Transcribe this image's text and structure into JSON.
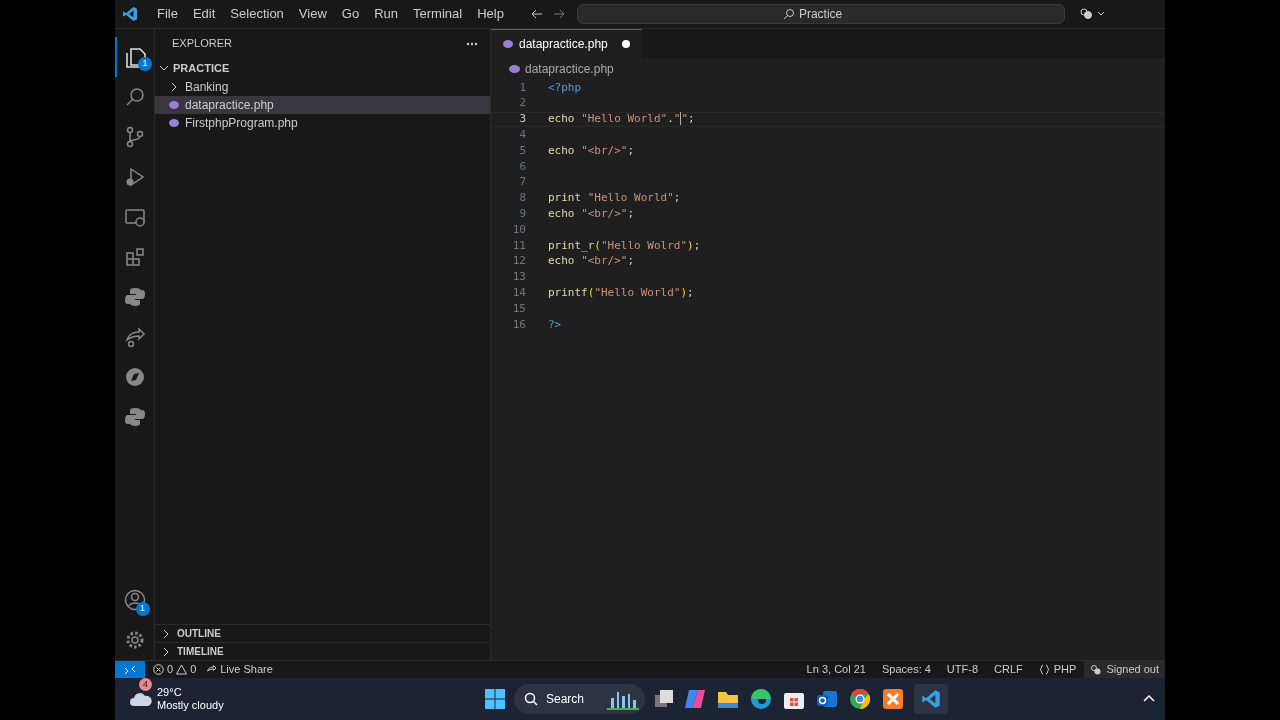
{
  "menu": [
    "File",
    "Edit",
    "Selection",
    "View",
    "Go",
    "Run",
    "Terminal",
    "Help"
  ],
  "command_center": {
    "placeholder": "Practice"
  },
  "activity_bar": {
    "explorer_badge": "1",
    "account_badge": "1"
  },
  "explorer": {
    "title": "EXPLORER",
    "folder": "PRACTICE",
    "items": [
      {
        "label": "Banking",
        "kind": "folder",
        "expanded": false,
        "selected": false
      },
      {
        "label": "datapractice.php",
        "kind": "php",
        "selected": true
      },
      {
        "label": "FirstphpProgram.php",
        "kind": "php",
        "selected": false
      }
    ],
    "sections": [
      "OUTLINE",
      "TIMELINE"
    ]
  },
  "tabs": [
    {
      "label": "datapractice.php",
      "modified": true,
      "selected": true
    }
  ],
  "breadcrumb": "datapractice.php",
  "editor": {
    "lines": [
      {
        "number": "1",
        "tokens": [
          {
            "kind": "tag",
            "text": "<?php"
          }
        ]
      },
      {
        "number": "2"
      },
      {
        "number": "3",
        "current": true,
        "tokens": [
          {
            "kind": "keyword",
            "text": "echo "
          },
          {
            "kind": "string",
            "text": "\"Hello World\""
          },
          {
            "kind": "plain",
            "text": "."
          },
          {
            "kind": "string",
            "text": "\""
          },
          {
            "kind": "string",
            "text": "\"",
            "cursor": true
          },
          {
            "kind": "plain",
            "text": ";"
          }
        ]
      },
      {
        "number": "4"
      },
      {
        "number": "5",
        "tokens": [
          {
            "kind": "keyword",
            "text": "echo "
          },
          {
            "kind": "string",
            "text": "\"<br/>\""
          },
          {
            "kind": "plain",
            "text": ";"
          }
        ]
      },
      {
        "number": "6"
      },
      {
        "number": "7"
      },
      {
        "number": "8",
        "tokens": [
          {
            "kind": "keyword",
            "text": "print "
          },
          {
            "kind": "string",
            "text": "\"Hello World\""
          },
          {
            "kind": "plain",
            "text": ";"
          }
        ]
      },
      {
        "number": "9",
        "tokens": [
          {
            "kind": "keyword",
            "text": "echo "
          },
          {
            "kind": "string",
            "text": "\"<br/>\""
          },
          {
            "kind": "plain",
            "text": ";"
          }
        ]
      },
      {
        "number": "10"
      },
      {
        "number": "11",
        "tokens": [
          {
            "kind": "keyword",
            "text": "print_r"
          },
          {
            "kind": "paren",
            "text": "("
          },
          {
            "kind": "string",
            "text": "\"Hello Wolrd\""
          },
          {
            "kind": "paren",
            "text": ")"
          },
          {
            "kind": "plain",
            "text": ";"
          }
        ]
      },
      {
        "number": "12",
        "tokens": [
          {
            "kind": "keyword",
            "text": "echo "
          },
          {
            "kind": "string",
            "text": "\"<br/>\""
          },
          {
            "kind": "plain",
            "text": ";"
          }
        ]
      },
      {
        "number": "13"
      },
      {
        "number": "14",
        "tokens": [
          {
            "kind": "keyword",
            "text": "printf"
          },
          {
            "kind": "paren",
            "text": "("
          },
          {
            "kind": "string",
            "text": "\"Hello World\""
          },
          {
            "kind": "paren",
            "text": ")"
          },
          {
            "kind": "plain",
            "text": ";"
          }
        ]
      },
      {
        "number": "15"
      },
      {
        "number": "16",
        "tokens": [
          {
            "kind": "tag",
            "text": "?>"
          }
        ]
      }
    ]
  },
  "status_bar": {
    "errors": "0",
    "warnings": "0",
    "live_share": "Live Share",
    "position": "Ln 3, Col 21",
    "spaces": "Spaces: 4",
    "encoding": "UTF-8",
    "eol": "CRLF",
    "language": "PHP",
    "account": "Signed out"
  },
  "taskbar": {
    "weather_badge": "4",
    "temperature": "29°C",
    "weather": "Mostly cloudy",
    "search": "Search"
  }
}
